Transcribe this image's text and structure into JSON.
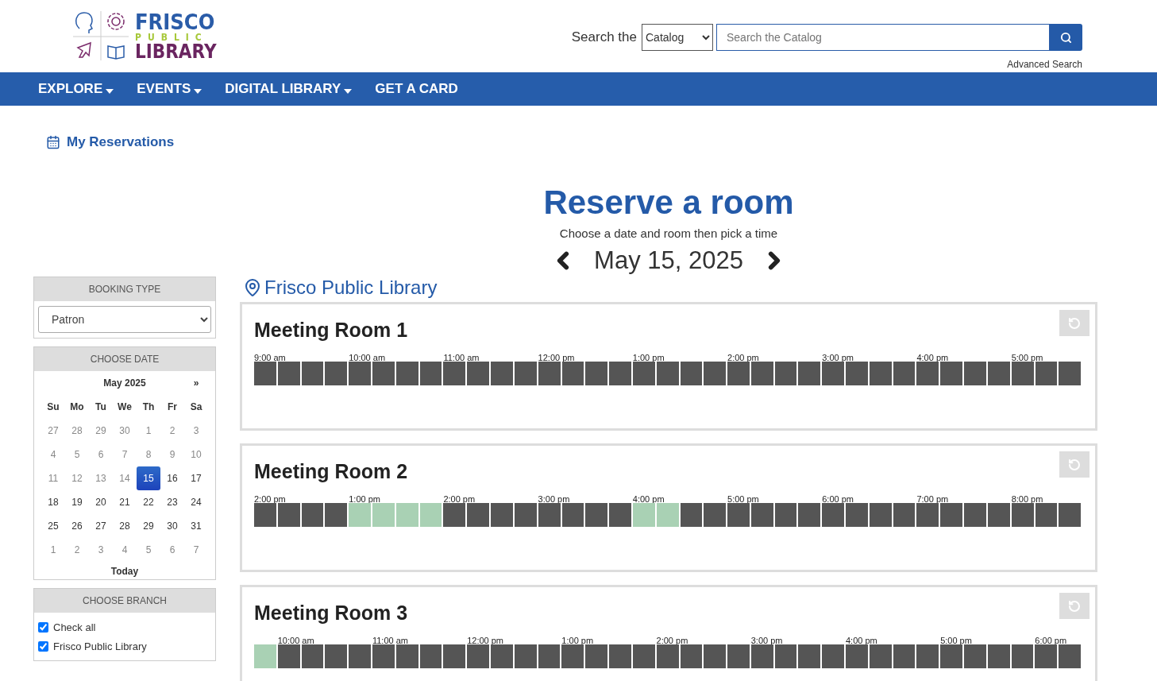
{
  "logo": {
    "line_1": "FRISCO",
    "line_2": "PUBLIC",
    "line_3": "LIBRARY"
  },
  "search": {
    "label": "Search the",
    "scope": "Catalog",
    "placeholder": "Search the Catalog",
    "advanced": "Advanced Search"
  },
  "nav": [
    {
      "label": "EXPLORE",
      "has_menu": true
    },
    {
      "label": "EVENTS",
      "has_menu": true
    },
    {
      "label": "DIGITAL LIBRARY",
      "has_menu": true
    },
    {
      "label": "GET A CARD",
      "has_menu": false
    }
  ],
  "my_reservations": "My Reservations",
  "title": "Reserve a room",
  "subtitle": "Choose a date and room then pick a time",
  "date": "May 15, 2025",
  "sidebar": {
    "booking_type": {
      "header": "BOOKING TYPE",
      "value": "Patron"
    },
    "calendar": {
      "header": "CHOOSE DATE",
      "month": "May 2025",
      "next": "»",
      "weekdays": [
        "Su",
        "Mo",
        "Tu",
        "We",
        "Th",
        "Fr",
        "Sa"
      ],
      "today": "Today",
      "weeks": [
        [
          {
            "day": "27",
            "muted": true,
            "selected": false
          },
          {
            "day": "28",
            "muted": true,
            "selected": false
          },
          {
            "day": "29",
            "muted": true,
            "selected": false
          },
          {
            "day": "30",
            "muted": true,
            "selected": false
          },
          {
            "day": "1",
            "muted": true,
            "selected": false
          },
          {
            "day": "2",
            "muted": true,
            "selected": false
          },
          {
            "day": "3",
            "muted": true,
            "selected": false
          }
        ],
        [
          {
            "day": "4",
            "muted": true,
            "selected": false
          },
          {
            "day": "5",
            "muted": true,
            "selected": false
          },
          {
            "day": "6",
            "muted": true,
            "selected": false
          },
          {
            "day": "7",
            "muted": true,
            "selected": false
          },
          {
            "day": "8",
            "muted": true,
            "selected": false
          },
          {
            "day": "9",
            "muted": true,
            "selected": false
          },
          {
            "day": "10",
            "muted": true,
            "selected": false
          }
        ],
        [
          {
            "day": "11",
            "muted": true,
            "selected": false
          },
          {
            "day": "12",
            "muted": true,
            "selected": false
          },
          {
            "day": "13",
            "muted": true,
            "selected": false
          },
          {
            "day": "14",
            "muted": true,
            "selected": false
          },
          {
            "day": "15",
            "muted": false,
            "selected": true
          },
          {
            "day": "16",
            "muted": false,
            "selected": false
          },
          {
            "day": "17",
            "muted": false,
            "selected": false
          }
        ],
        [
          {
            "day": "18",
            "muted": false,
            "selected": false
          },
          {
            "day": "19",
            "muted": false,
            "selected": false
          },
          {
            "day": "20",
            "muted": false,
            "selected": false
          },
          {
            "day": "21",
            "muted": false,
            "selected": false
          },
          {
            "day": "22",
            "muted": false,
            "selected": false
          },
          {
            "day": "23",
            "muted": false,
            "selected": false
          },
          {
            "day": "24",
            "muted": false,
            "selected": false
          }
        ],
        [
          {
            "day": "25",
            "muted": false,
            "selected": false
          },
          {
            "day": "26",
            "muted": false,
            "selected": false
          },
          {
            "day": "27",
            "muted": false,
            "selected": false
          },
          {
            "day": "28",
            "muted": false,
            "selected": false
          },
          {
            "day": "29",
            "muted": false,
            "selected": false
          },
          {
            "day": "30",
            "muted": false,
            "selected": false
          },
          {
            "day": "31",
            "muted": false,
            "selected": false
          }
        ],
        [
          {
            "day": "1",
            "muted": true,
            "selected": false
          },
          {
            "day": "2",
            "muted": true,
            "selected": false
          },
          {
            "day": "3",
            "muted": true,
            "selected": false
          },
          {
            "day": "4",
            "muted": true,
            "selected": false
          },
          {
            "day": "5",
            "muted": true,
            "selected": false
          },
          {
            "day": "6",
            "muted": true,
            "selected": false
          },
          {
            "day": "7",
            "muted": true,
            "selected": false
          }
        ]
      ]
    },
    "branch": {
      "header": "CHOOSE BRANCH",
      "options": [
        {
          "label": "Check all",
          "checked": true
        },
        {
          "label": "Frisco Public Library",
          "checked": true
        }
      ]
    }
  },
  "location": "Frisco Public Library",
  "rooms": [
    {
      "name": "Meeting Room 1",
      "slots": [
        {
          "label": "9:00 am",
          "available": false
        },
        {
          "available": false
        },
        {
          "available": false
        },
        {
          "available": false
        },
        {
          "label": "10:00 am",
          "available": false
        },
        {
          "available": false
        },
        {
          "available": false
        },
        {
          "available": false
        },
        {
          "label": "11:00 am",
          "available": false
        },
        {
          "available": false
        },
        {
          "available": false
        },
        {
          "available": false
        },
        {
          "label": "12:00 pm",
          "available": false
        },
        {
          "available": false
        },
        {
          "available": false
        },
        {
          "available": false
        },
        {
          "label": "1:00 pm",
          "available": false
        },
        {
          "available": false
        },
        {
          "available": false
        },
        {
          "available": false
        },
        {
          "label": "2:00 pm",
          "available": false
        },
        {
          "available": false
        },
        {
          "available": false
        },
        {
          "available": false
        },
        {
          "label": "3:00 pm",
          "available": false
        },
        {
          "available": false
        },
        {
          "available": false
        },
        {
          "available": false
        },
        {
          "label": "4:00 pm",
          "available": false
        },
        {
          "available": false
        },
        {
          "available": false
        },
        {
          "available": false
        },
        {
          "label": "5:00 pm",
          "available": false
        },
        {
          "available": false
        },
        {
          "available": false
        }
      ]
    },
    {
      "name": "Meeting Room 2",
      "slots": [
        {
          "label": "2:00 pm",
          "available": false
        },
        {
          "available": false
        },
        {
          "available": false
        },
        {
          "available": false
        },
        {
          "label": "1:00 pm",
          "available": true
        },
        {
          "available": true
        },
        {
          "available": true
        },
        {
          "available": true
        },
        {
          "label": "2:00 pm",
          "available": false
        },
        {
          "available": false
        },
        {
          "available": false
        },
        {
          "available": false
        },
        {
          "label": "3:00 pm",
          "available": false
        },
        {
          "available": false
        },
        {
          "available": false
        },
        {
          "available": false
        },
        {
          "label": "4:00 pm",
          "available": true
        },
        {
          "available": true
        },
        {
          "available": false
        },
        {
          "available": false
        },
        {
          "label": "5:00 pm",
          "available": false
        },
        {
          "available": false
        },
        {
          "available": false
        },
        {
          "available": false
        },
        {
          "label": "6:00 pm",
          "available": false
        },
        {
          "available": false
        },
        {
          "available": false
        },
        {
          "available": false
        },
        {
          "label": "7:00 pm",
          "available": false
        },
        {
          "available": false
        },
        {
          "available": false
        },
        {
          "available": false
        },
        {
          "label": "8:00 pm",
          "available": false
        },
        {
          "available": false
        },
        {
          "available": false
        }
      ]
    },
    {
      "name": "Meeting Room 3",
      "slots": [
        {
          "available": true
        },
        {
          "label": "10:00 am",
          "available": false
        },
        {
          "available": false
        },
        {
          "available": false
        },
        {
          "available": false
        },
        {
          "label": "11:00 am",
          "available": false
        },
        {
          "available": false
        },
        {
          "available": false
        },
        {
          "available": false
        },
        {
          "label": "12:00 pm",
          "available": false
        },
        {
          "available": false
        },
        {
          "available": false
        },
        {
          "available": false
        },
        {
          "label": "1:00 pm",
          "available": false
        },
        {
          "available": false
        },
        {
          "available": false
        },
        {
          "available": false
        },
        {
          "label": "2:00 pm",
          "available": false
        },
        {
          "available": false
        },
        {
          "available": false
        },
        {
          "available": false
        },
        {
          "label": "3:00 pm",
          "available": false
        },
        {
          "available": false
        },
        {
          "available": false
        },
        {
          "available": false
        },
        {
          "label": "4:00 pm",
          "available": false
        },
        {
          "available": false
        },
        {
          "available": false
        },
        {
          "available": false
        },
        {
          "label": "5:00 pm",
          "available": false
        },
        {
          "available": false
        },
        {
          "available": false
        },
        {
          "available": false
        },
        {
          "label": "6:00 pm",
          "available": false
        },
        {
          "available": false
        }
      ]
    }
  ]
}
